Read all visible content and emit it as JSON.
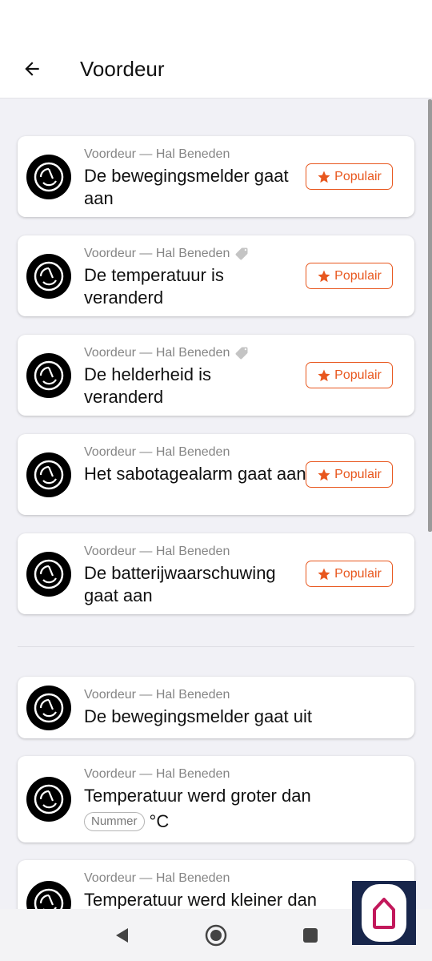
{
  "header": {
    "title": "Voordeur"
  },
  "popular_label": "Populair",
  "cards": [
    {
      "meta": "Voordeur — Hal Beneden",
      "name": "De bewegingsmelder gaat aan",
      "tag": false,
      "popular": true
    },
    {
      "meta": "Voordeur — Hal Beneden",
      "name": "De temperatuur is veranderd",
      "tag": true,
      "popular": true
    },
    {
      "meta": "Voordeur — Hal Beneden",
      "name": "De helderheid is veranderd",
      "tag": true,
      "popular": true
    },
    {
      "meta": "Voordeur — Hal Beneden",
      "name": "Het sabotagealarm gaat aan",
      "tag": false,
      "popular": true
    },
    {
      "meta": "Voordeur — Hal Beneden",
      "name": "De batterijwaarschuwing gaat aan",
      "tag": false,
      "popular": true
    },
    {
      "meta": "Voordeur — Hal Beneden",
      "name": "De bewegingsmelder gaat uit",
      "tag": false,
      "popular": false
    },
    {
      "meta": "Voordeur — Hal Beneden",
      "name": "Temperatuur werd groter dan",
      "pill": "Nummer",
      "unit": "°C",
      "tag": false,
      "popular": false
    },
    {
      "meta": "Voordeur — Hal Beneden",
      "name": "Temperatuur werd kleiner dan",
      "tag": false,
      "popular": false
    }
  ],
  "colors": {
    "accent": "#e8571e",
    "app_icon_bg": "#18264b",
    "app_icon_fg": "#c2185b"
  },
  "icons": {
    "back": "arrow-left-icon",
    "device": "motion-sensor-icon",
    "tag": "tag-icon",
    "star": "star-icon",
    "nav_back": "triangle-back-icon",
    "nav_home": "circle-home-icon",
    "nav_recents": "square-recents-icon",
    "app": "house-app-icon"
  }
}
